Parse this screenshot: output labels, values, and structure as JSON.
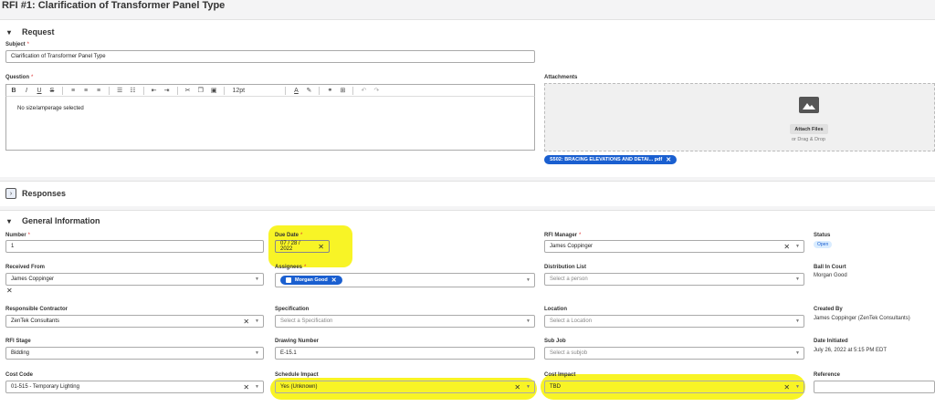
{
  "page": {
    "title": "RFI #1: Clarification of Transformer Panel Type"
  },
  "request": {
    "header": "Request",
    "subject_label": "Subject",
    "subject_value": "Clarification of Transformer Panel Type",
    "question_label": "Question",
    "question_text": "No size/amperage selected",
    "font_size": "12pt",
    "attachments_label": "Attachments",
    "attach_button": "Attach Files",
    "drag_drop": "or Drag & Drop",
    "attachment_chip": "S502: BRACING ELEVATIONS AND DETAI... pdf"
  },
  "responses": {
    "header": "Responses"
  },
  "general": {
    "header": "General Information",
    "number_label": "Number",
    "number_value": "1",
    "due_date_label": "Due Date",
    "due_date_value": "07 / 28 / 2022",
    "rfi_manager_label": "RFI Manager",
    "rfi_manager_value": "James Coppinger",
    "status_label": "Status",
    "status_value": "Open",
    "received_from_label": "Received From",
    "received_from_value": "James Coppinger",
    "assignees_label": "Assignees",
    "assignee_chip": "Morgan Good",
    "distribution_label": "Distribution List",
    "distribution_placeholder": "Select a person",
    "ball_label": "Ball In Court",
    "ball_value": "Morgan Good",
    "contractor_label": "Responsible Contractor",
    "contractor_value": "ZenTek Consultants",
    "spec_label": "Specification",
    "spec_placeholder": "Select a Specification",
    "location_label": "Location",
    "location_placeholder": "Select a Location",
    "created_label": "Created By",
    "created_value": "James Coppinger (ZenTek Consultants)",
    "stage_label": "RFI Stage",
    "stage_value": "Bidding",
    "drawing_label": "Drawing Number",
    "drawing_value": "E-15.1",
    "subjob_label": "Sub Job",
    "subjob_placeholder": "Select a subjob",
    "initiated_label": "Date Initiated",
    "initiated_value": "July 26, 2022 at 5:15 PM EDT",
    "costcode_label": "Cost Code",
    "costcode_value": "01-515 - Temporary Lighting",
    "schedule_label": "Schedule Impact",
    "schedule_value": "Yes (Unknown)",
    "cost_label": "Cost Impact",
    "cost_value": "TBD",
    "reference_label": "Reference"
  },
  "colors": {
    "highlight": "#f7f200",
    "chip": "#1a5fd0"
  }
}
